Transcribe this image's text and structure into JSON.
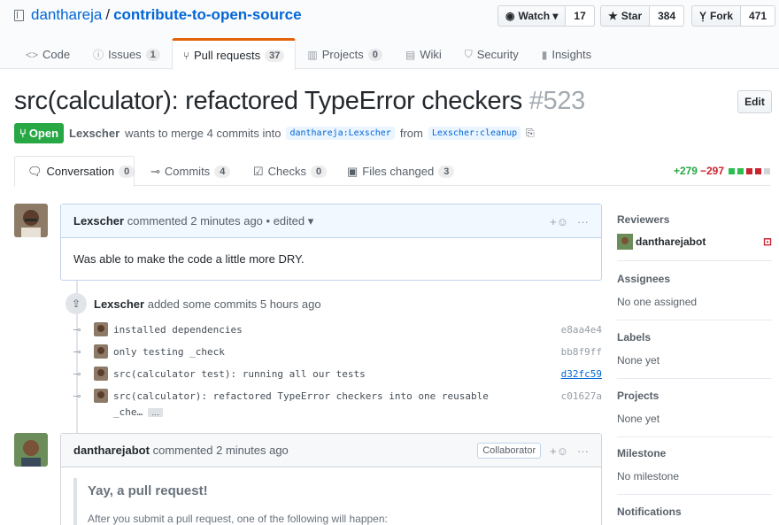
{
  "repo": {
    "owner": "danthareja",
    "sep": "/",
    "name": "contribute-to-open-source"
  },
  "actions": [
    {
      "label": "Watch ▾",
      "icon": "eye-icon",
      "count": "17"
    },
    {
      "label": "Star",
      "icon": "star-icon",
      "count": "384"
    },
    {
      "label": "Fork",
      "icon": "fork-icon",
      "count": "471"
    }
  ],
  "nav": [
    {
      "label": "Code",
      "icon": "code-icon"
    },
    {
      "label": "Issues",
      "count": "1",
      "icon": "issue-icon"
    },
    {
      "label": "Pull requests",
      "count": "37",
      "icon": "pull-request-icon"
    },
    {
      "label": "Projects",
      "count": "0",
      "icon": "project-icon"
    },
    {
      "label": "Wiki",
      "icon": "wiki-icon"
    },
    {
      "label": "Security",
      "icon": "shield-icon"
    },
    {
      "label": "Insights",
      "icon": "graph-icon"
    }
  ],
  "pr": {
    "title": "src(calculator): refactored TypeError checkers",
    "number": "#523",
    "edit_label": "Edit",
    "state": "Open",
    "author": "Lexscher",
    "merge_text": "wants to merge 4 commits into",
    "base_branch": "danthareja:Lexscher",
    "from_text": "from",
    "head_branch": "Lexscher:cleanup"
  },
  "pr_tabs": [
    {
      "label": "Conversation",
      "count": "0",
      "icon": "comment-icon"
    },
    {
      "label": "Commits",
      "count": "4",
      "icon": "commit-icon"
    },
    {
      "label": "Checks",
      "count": "0",
      "icon": "checklist-icon"
    },
    {
      "label": "Files changed",
      "count": "3",
      "icon": "file-diff-icon"
    }
  ],
  "diffstat": {
    "additions": "+279",
    "deletions": "−297"
  },
  "comment1": {
    "author": "Lexscher",
    "meta": "commented 2 minutes ago • edited ▾",
    "body": "Was able to make the code a little more DRY."
  },
  "commits_event": {
    "author": "Lexscher",
    "text": "added some commits 5 hours ago"
  },
  "commits": [
    {
      "message": "installed dependencies",
      "sha": "e8aa4e4"
    },
    {
      "message": "only testing _check",
      "sha": "bb8f9ff"
    },
    {
      "message": "src(calculator test): running all our tests",
      "sha": "d32fc59"
    },
    {
      "message": "src(calculator): refactored TypeError checkers into one reusable",
      "message2": "_che…",
      "more": "…",
      "sha": "c01627a"
    }
  ],
  "comment2": {
    "author": "dantharejabot",
    "meta": "commented 2 minutes ago",
    "badge": "Collaborator",
    "heading": "Yay, a pull request!",
    "body": "After you submit a pull request, one of the following will happen:"
  },
  "sidebar": {
    "reviewers": {
      "heading": "Reviewers",
      "name": "dantharejabot"
    },
    "assignees": {
      "heading": "Assignees",
      "value": "No one assigned"
    },
    "labels": {
      "heading": "Labels",
      "value": "None yet"
    },
    "projects": {
      "heading": "Projects",
      "value": "None yet"
    },
    "milestone": {
      "heading": "Milestone",
      "value": "No milestone"
    },
    "notifications": {
      "heading": "Notifications"
    }
  },
  "colors": {
    "accent": "#0366d6",
    "open": "#28a745",
    "tab_active": "#e36209",
    "additions": "#28a745",
    "deletions": "#cb2431"
  }
}
